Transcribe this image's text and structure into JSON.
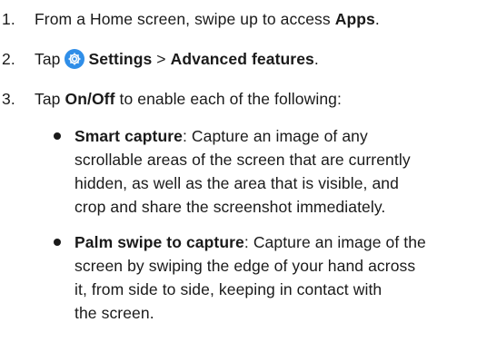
{
  "steps": [
    {
      "num": "1.",
      "pre": "From a Home screen, swipe up to access ",
      "bold": "Apps",
      "post": "."
    },
    {
      "num": "2.",
      "pre": "Tap ",
      "bold1": "Settings",
      "sep": " > ",
      "bold2": "Advanced features",
      "post": ".",
      "icon": "settings-gear-icon"
    },
    {
      "num": "3.",
      "pre": "Tap ",
      "bold": "On/Off",
      "post": " to enable each of the following:"
    }
  ],
  "bullets": [
    {
      "title": "Smart capture",
      "lines": [
        ": Capture an image of any",
        "scrollable areas of the screen that are currently",
        "hidden, as well as the area that is visible, and",
        "crop and share the screenshot immediately."
      ]
    },
    {
      "title": "Palm swipe to capture",
      "lines": [
        ": Capture an image of the",
        "screen by swiping the edge of your hand across",
        "it, from side to side, keeping in contact with",
        "the screen."
      ]
    }
  ],
  "colors": {
    "icon_bg": "#2f8ee8",
    "text": "#1a1a1a"
  }
}
